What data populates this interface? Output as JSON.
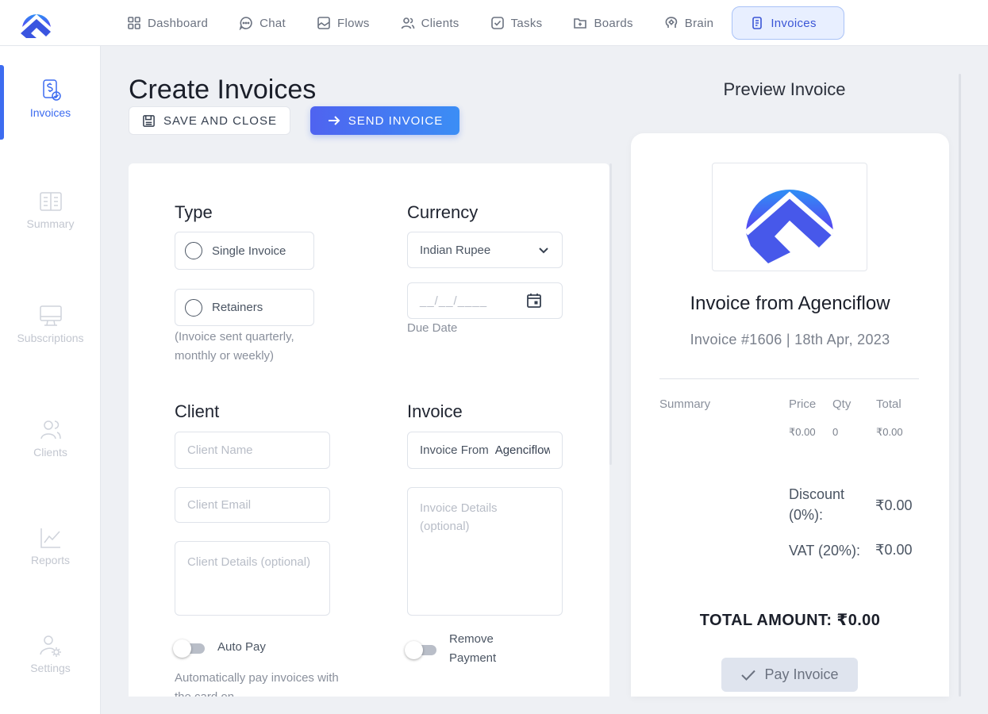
{
  "nav": {
    "items": [
      {
        "label": "Dashboard",
        "icon": "dashboard-icon"
      },
      {
        "label": "Chat",
        "icon": "chat-icon"
      },
      {
        "label": "Flows",
        "icon": "flows-icon"
      },
      {
        "label": "Clients",
        "icon": "clients-icon"
      },
      {
        "label": "Tasks",
        "icon": "tasks-icon"
      },
      {
        "label": "Boards",
        "icon": "boards-icon"
      },
      {
        "label": "Brain",
        "icon": "brain-icon"
      },
      {
        "label": "Invoices",
        "icon": "invoice-icon"
      }
    ],
    "active": "Invoices"
  },
  "sidebar": {
    "items": [
      {
        "label": "Invoices",
        "icon": "invoice-dollar-icon"
      },
      {
        "label": "Summary",
        "icon": "summary-icon"
      },
      {
        "label": "Subscriptions",
        "icon": "subscriptions-icon"
      },
      {
        "label": "Clients",
        "icon": "clients-icon"
      },
      {
        "label": "Reports",
        "icon": "reports-icon"
      },
      {
        "label": "Settings",
        "icon": "settings-icon"
      }
    ],
    "active": "Invoices"
  },
  "header": {
    "title": "Create Invoices",
    "save_label": "SAVE AND CLOSE",
    "send_label": "SEND INVOICE"
  },
  "form": {
    "type": {
      "label": "Type",
      "single": "Single Invoice",
      "retainers": "Retainers",
      "retainers_hint": "(Invoice sent quarterly, monthly or weekly)"
    },
    "currency": {
      "label": "Currency",
      "selected": "Indian Rupee",
      "date_placeholder": "__/__/____",
      "due_date_label": "Due Date"
    },
    "client": {
      "label": "Client",
      "name_placeholder": "Client Name",
      "email_placeholder": "Client Email",
      "details_placeholder": "Client Details (optional)"
    },
    "invoice": {
      "label": "Invoice",
      "from_label": "Invoice From",
      "from_value": "Agenciflow",
      "details_placeholder": "Invoice Details (optional)"
    },
    "auto_pay": {
      "label": "Auto Pay",
      "hint": "Automatically pay invoices with the card on",
      "enabled": false
    },
    "remove_payment": {
      "label": "Remove Payment",
      "enabled": false
    }
  },
  "preview": {
    "title": "Preview Invoice",
    "heading": "Invoice from Agenciflow",
    "meta": "Invoice #1606 | 18th Apr, 2023",
    "table": {
      "headers": [
        "Summary",
        "Price",
        "Qty",
        "Total"
      ],
      "row": [
        "₹0.00",
        "0",
        "₹0.00"
      ]
    },
    "discount_label": "Discount (0%):",
    "discount_value": "₹0.00",
    "vat_label": "VAT (20%):",
    "vat_value": "₹0.00",
    "total": "TOTAL AMOUNT: ₹0.00",
    "pay_label": "Pay Invoice"
  },
  "colors": {
    "accent": "#3d6cf0",
    "send_gradient_start": "#4f63f0",
    "send_gradient_end": "#3b8ef5",
    "logo_top": "#2f8ff5",
    "logo_bottom": "#5a3ff0"
  }
}
